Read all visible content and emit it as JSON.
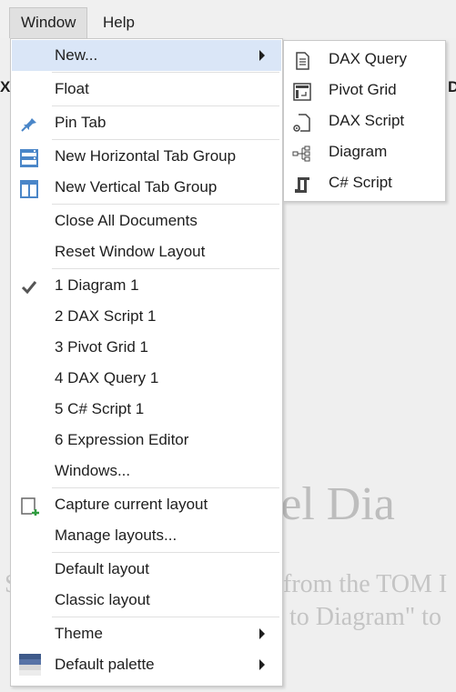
{
  "menubar": {
    "items": [
      "Window",
      "Help"
    ]
  },
  "background": {
    "tab_left": "X",
    "tab_right": "D",
    "title_fragment": "Model Dia",
    "line1_fragment": "S",
    "line1b_fragment": "from the TOM I",
    "line2_fragment": "to Diagram\" to"
  },
  "window_menu": {
    "items": [
      {
        "label": "New...",
        "submenu": true,
        "highlighted": true
      },
      {
        "sep": true
      },
      {
        "label": "Float"
      },
      {
        "sep": true
      },
      {
        "label": "Pin Tab",
        "icon": "pin-icon"
      },
      {
        "sep": true
      },
      {
        "label": "New Horizontal Tab Group",
        "icon": "horizontal-tab-group-icon"
      },
      {
        "label": "New Vertical Tab Group",
        "icon": "vertical-tab-group-icon"
      },
      {
        "sep": true
      },
      {
        "label": "Close All Documents"
      },
      {
        "label": "Reset Window Layout"
      },
      {
        "sep": true
      },
      {
        "label": "1 Diagram 1",
        "icon": "checkmark-icon",
        "checked": true
      },
      {
        "label": "2 DAX Script 1"
      },
      {
        "label": "3 Pivot Grid 1"
      },
      {
        "label": "4 DAX Query 1"
      },
      {
        "label": "5 C# Script 1"
      },
      {
        "label": "6 Expression Editor"
      },
      {
        "label": "Windows..."
      },
      {
        "sep": true
      },
      {
        "label": "Capture current layout",
        "icon": "capture-layout-icon"
      },
      {
        "label": "Manage layouts..."
      },
      {
        "sep": true
      },
      {
        "label": "Default layout"
      },
      {
        "label": "Classic layout"
      },
      {
        "sep": true
      },
      {
        "label": "Theme",
        "submenu": true
      },
      {
        "label": "Default palette",
        "icon": "palette-icon",
        "submenu": true
      }
    ]
  },
  "new_submenu": {
    "items": [
      {
        "label": "DAX Query",
        "icon": "document-icon"
      },
      {
        "label": "Pivot Grid",
        "icon": "pivot-grid-icon"
      },
      {
        "label": "DAX Script",
        "icon": "dax-script-icon"
      },
      {
        "label": "Diagram",
        "icon": "diagram-icon"
      },
      {
        "label": "C# Script",
        "icon": "csharp-script-icon"
      }
    ]
  },
  "colors": {
    "highlight": "#dae6f7",
    "icon_blue": "#4a86c8",
    "icon_gray": "#555555",
    "add_green": "#2e9b3e",
    "palette_dark": "#3e5a8a"
  }
}
